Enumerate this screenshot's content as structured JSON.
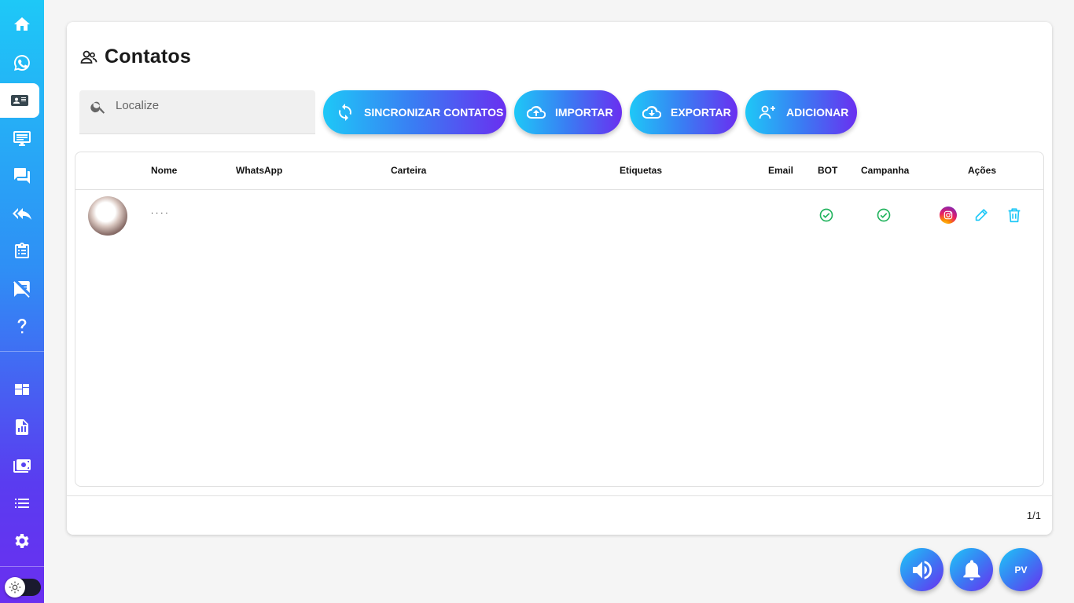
{
  "sidebar": {
    "items": [
      {
        "icon": "home-icon"
      },
      {
        "icon": "whatsapp-icon"
      },
      {
        "icon": "contact-card-icon",
        "active": true
      },
      {
        "icon": "monitor-icon"
      },
      {
        "icon": "chat-icon"
      },
      {
        "icon": "reply-all-icon"
      },
      {
        "icon": "clipboard-icon"
      },
      {
        "icon": "message-off-icon"
      },
      {
        "icon": "help-icon"
      },
      {
        "icon": "dashboard-icon"
      },
      {
        "icon": "report-icon"
      },
      {
        "icon": "money-icon"
      },
      {
        "icon": "list-icon"
      },
      {
        "icon": "settings-icon"
      }
    ],
    "theme_toggle_icon": "sun-icon"
  },
  "page": {
    "title": "Contatos",
    "search": {
      "placeholder": "Localize",
      "value": ""
    },
    "buttons": {
      "sync": "SINCRONIZAR CONTATOS",
      "import": "IMPORTAR",
      "export": "EXPORTAR",
      "add": "ADICIONAR"
    }
  },
  "table": {
    "headers": {
      "name": "Nome",
      "whatsapp": "WhatsApp",
      "wallet": "Carteira",
      "tags": "Etiquetas",
      "email": "Email",
      "bot": "BOT",
      "campaign": "Campanha",
      "actions": "Ações"
    },
    "rows": [
      {
        "name": ". . .          .",
        "whatsapp": "",
        "wallet": "",
        "tags": "",
        "email": "",
        "bot": true,
        "campaign": true
      }
    ]
  },
  "pagination": {
    "text": "1/1"
  },
  "floating": {
    "pv_label": "PV"
  },
  "colors": {
    "accent_start": "#1ec8f7",
    "accent_end": "#6a2ff0",
    "ok_green": "#22b35e",
    "action_cyan": "#1ec8f7"
  }
}
